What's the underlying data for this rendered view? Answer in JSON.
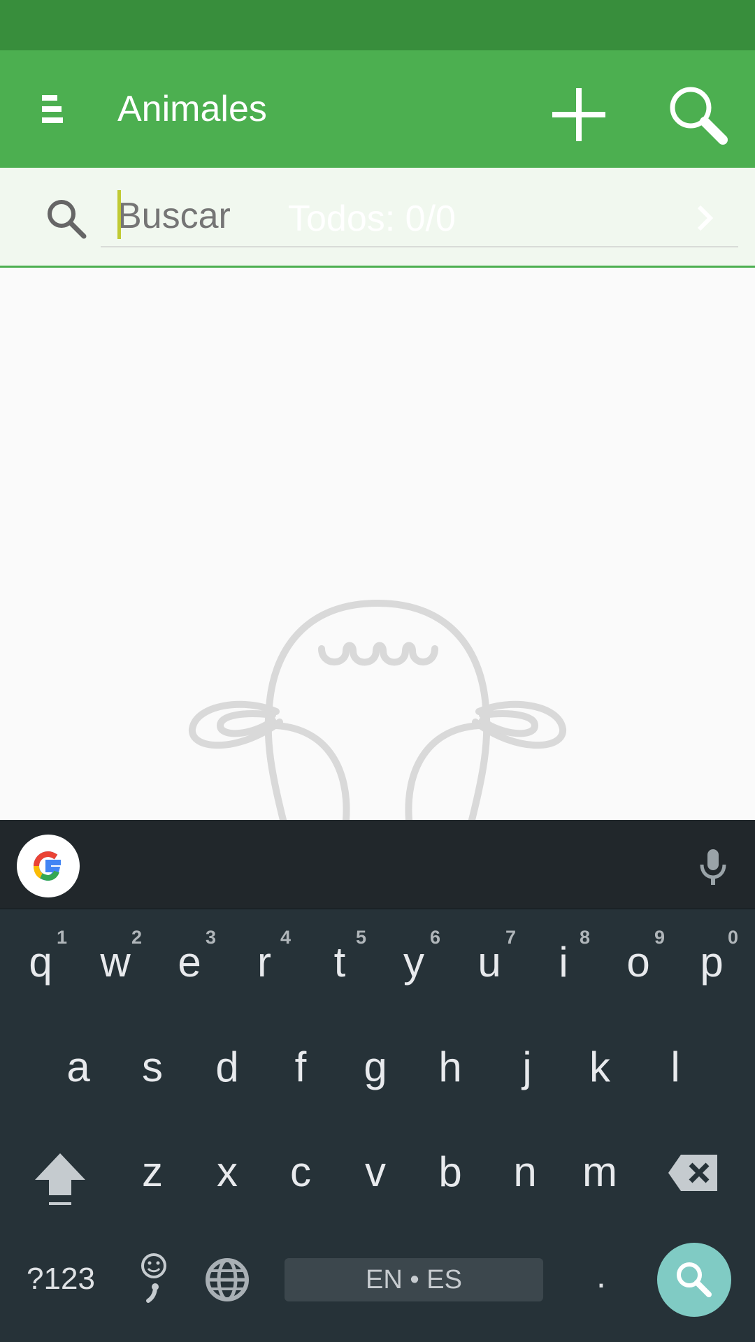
{
  "app_bar": {
    "title": "Animales",
    "menu_icon": "hamburger-menu-icon",
    "add_icon": "plus-icon",
    "search_icon": "search-icon",
    "color": "#4caf50",
    "status_bar_color": "#388e3c"
  },
  "search": {
    "placeholder": "Buscar",
    "value": "",
    "count_label": "Todos: 0/0",
    "leading_icon": "search-icon",
    "trailing_icon": "chevron-right-icon"
  },
  "empty_state": {
    "illustration": "cow-head-outline"
  },
  "keyboard": {
    "language_label": "EN • ES",
    "symbols_label": "?123",
    "period_label": ".",
    "row1": [
      {
        "key": "q",
        "sup": "1"
      },
      {
        "key": "w",
        "sup": "2"
      },
      {
        "key": "e",
        "sup": "3"
      },
      {
        "key": "r",
        "sup": "4"
      },
      {
        "key": "t",
        "sup": "5"
      },
      {
        "key": "y",
        "sup": "6"
      },
      {
        "key": "u",
        "sup": "7"
      },
      {
        "key": "i",
        "sup": "8"
      },
      {
        "key": "o",
        "sup": "9"
      },
      {
        "key": "p",
        "sup": "0"
      }
    ],
    "row2": [
      "a",
      "s",
      "d",
      "f",
      "g",
      "h",
      "j",
      "k",
      "l"
    ],
    "row3": [
      "z",
      "x",
      "c",
      "v",
      "b",
      "n",
      "m"
    ],
    "accent_color": "#80cbc4"
  }
}
